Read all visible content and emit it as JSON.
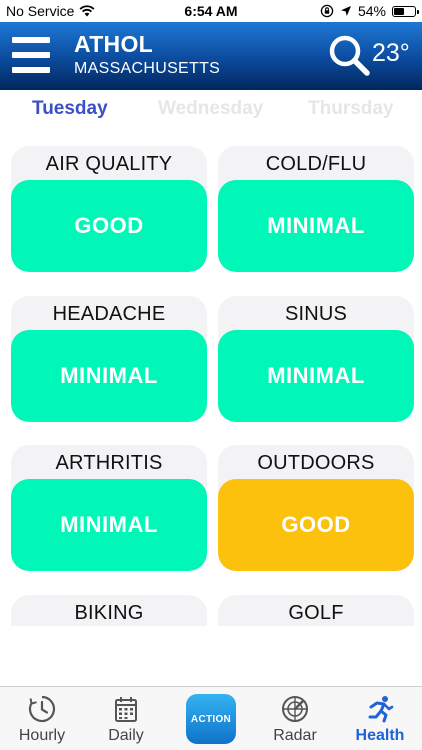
{
  "status_bar": {
    "carrier": "No Service",
    "time": "6:54 AM",
    "battery_percent": "54%",
    "battery_level": 0.54
  },
  "header": {
    "city": "ATHOL",
    "state": "MASSACHUSETTS",
    "temperature": "23°"
  },
  "tabs": [
    {
      "label": "Tuesday",
      "active": true
    },
    {
      "label": "Wednesday",
      "active": false
    },
    {
      "label": "Thursday",
      "active": false
    }
  ],
  "colors": {
    "good": "#00f7b8",
    "minimal": "#00f7b8",
    "outdoors_good": "#fcc10c",
    "accent": "#3a4fc9",
    "nav_active": "#1f63d6"
  },
  "cards": [
    {
      "title": "AIR QUALITY",
      "level": "GOOD",
      "color": "#00f7b8"
    },
    {
      "title": "COLD/FLU",
      "level": "MINIMAL",
      "color": "#00f7b8"
    },
    {
      "title": "HEADACHE",
      "level": "MINIMAL",
      "color": "#00f7b8"
    },
    {
      "title": "SINUS",
      "level": "MINIMAL",
      "color": "#00f7b8"
    },
    {
      "title": "ARTHRITIS",
      "level": "MINIMAL",
      "color": "#00f7b8"
    },
    {
      "title": "OUTDOORS",
      "level": "GOOD",
      "color": "#fcc10c"
    },
    {
      "title": "BIKING",
      "level": "",
      "color": "#00f7b8"
    },
    {
      "title": "GOLF",
      "level": "",
      "color": "#00f7b8"
    }
  ],
  "bottom_nav": [
    {
      "label": "Hourly",
      "icon": "clock-icon",
      "active": false
    },
    {
      "label": "Daily",
      "icon": "calendar-icon",
      "active": false
    },
    {
      "label": "",
      "icon": "weather-action-logo-icon",
      "active": false
    },
    {
      "label": "Radar",
      "icon": "radar-icon",
      "active": false
    },
    {
      "label": "Health",
      "icon": "runner-icon",
      "active": true
    }
  ]
}
